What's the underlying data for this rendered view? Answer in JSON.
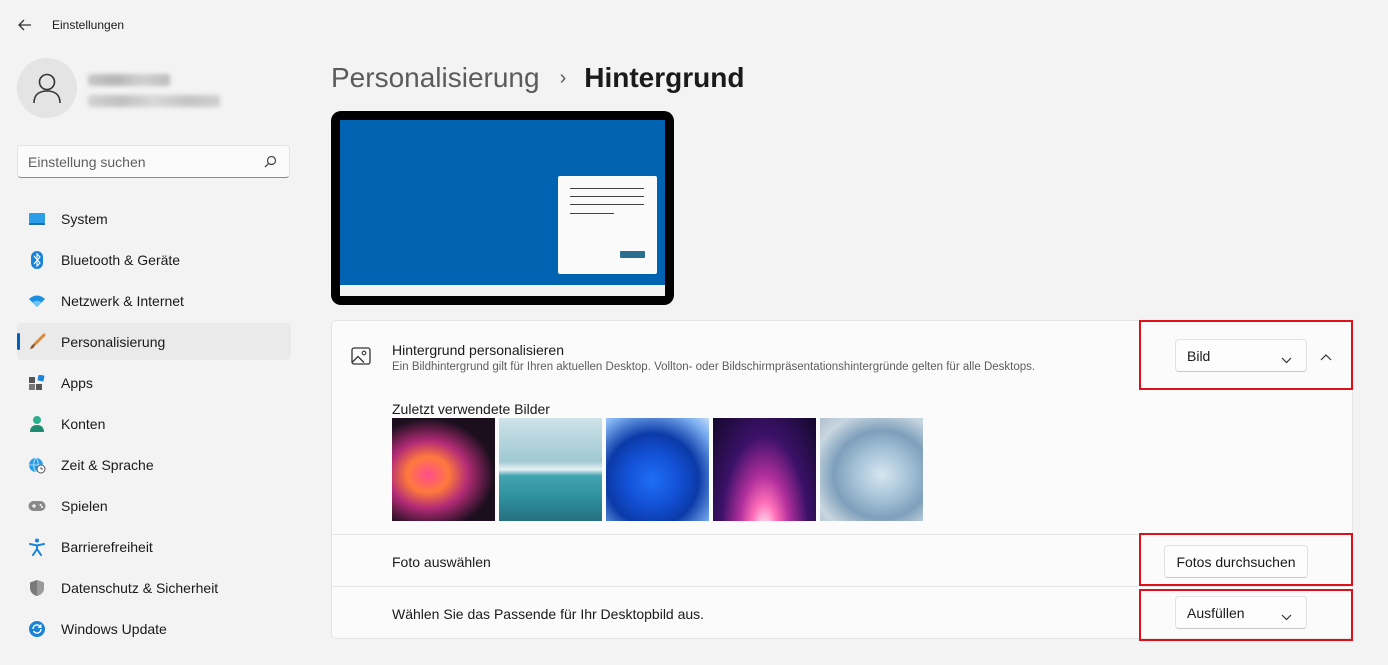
{
  "titlebar": {
    "title": "Einstellungen"
  },
  "search": {
    "placeholder": "Einstellung suchen"
  },
  "sidebar": {
    "items": [
      {
        "label": "System",
        "icon": "system-icon"
      },
      {
        "label": "Bluetooth & Geräte",
        "icon": "bluetooth-icon"
      },
      {
        "label": "Netzwerk & Internet",
        "icon": "wifi-icon"
      },
      {
        "label": "Personalisierung",
        "icon": "brush-icon",
        "active": true
      },
      {
        "label": "Apps",
        "icon": "apps-icon"
      },
      {
        "label": "Konten",
        "icon": "person-icon"
      },
      {
        "label": "Zeit & Sprache",
        "icon": "globe-clock-icon"
      },
      {
        "label": "Spielen",
        "icon": "gamepad-icon"
      },
      {
        "label": "Barrierefreiheit",
        "icon": "accessibility-icon"
      },
      {
        "label": "Datenschutz & Sicherheit",
        "icon": "shield-icon"
      },
      {
        "label": "Windows Update",
        "icon": "update-icon"
      }
    ]
  },
  "breadcrumb": {
    "parent": "Personalisierung",
    "separator": "›",
    "current": "Hintergrund"
  },
  "background": {
    "title": "Hintergrund personalisieren",
    "subtitle": "Ein Bildhintergrund gilt für Ihren aktuellen Desktop. Vollton- oder Bildschirmpräsentationshintergründe gelten für alle Desktops.",
    "dropdown_value": "Bild"
  },
  "recent": {
    "label": "Zuletzt verwendete Bilder"
  },
  "photo": {
    "label": "Foto auswählen",
    "button": "Fotos durchsuchen"
  },
  "fit": {
    "label": "Wählen Sie das Passende für Ihr Desktopbild aus.",
    "dropdown_value": "Ausfüllen"
  },
  "colors": {
    "accent": "#005fb8",
    "highlight": "#e0101a",
    "preview_bg": "#0063b1"
  }
}
